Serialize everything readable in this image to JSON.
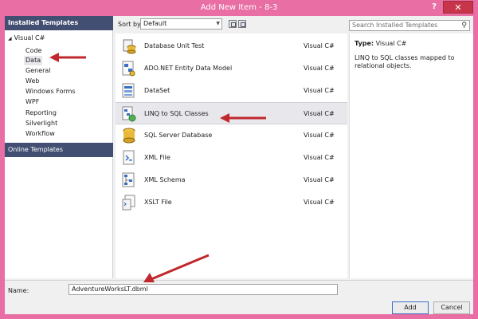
{
  "window": {
    "title": "Add New Item - 8-3",
    "help": "?",
    "close": "✕"
  },
  "left": {
    "header": "Installed Templates",
    "root": "Visual C#",
    "items": [
      {
        "label": "Code",
        "selected": false
      },
      {
        "label": "Data",
        "selected": true
      },
      {
        "label": "General",
        "selected": false
      },
      {
        "label": "Web",
        "selected": false
      },
      {
        "label": "Windows Forms",
        "selected": false
      },
      {
        "label": "WPF",
        "selected": false
      },
      {
        "label": "Reporting",
        "selected": false
      },
      {
        "label": "Silverlight",
        "selected": false
      },
      {
        "label": "Workflow",
        "selected": false
      }
    ],
    "online": "Online Templates"
  },
  "sortbar": {
    "label": "Sort by:",
    "value": "Default"
  },
  "search": {
    "placeholder": "Search Installed Templates"
  },
  "templates": [
    {
      "name": "Database Unit Test",
      "lang": "Visual C#",
      "icon": "database-unit-test-icon",
      "selected": false
    },
    {
      "name": "ADO.NET Entity Data Model",
      "lang": "Visual C#",
      "icon": "entity-data-model-icon",
      "selected": false
    },
    {
      "name": "DataSet",
      "lang": "Visual C#",
      "icon": "dataset-icon",
      "selected": false
    },
    {
      "name": "LINQ to SQL Classes",
      "lang": "Visual C#",
      "icon": "linq-to-sql-icon",
      "selected": true
    },
    {
      "name": "SQL Server Database",
      "lang": "Visual C#",
      "icon": "sql-database-icon",
      "selected": false
    },
    {
      "name": "XML File",
      "lang": "Visual C#",
      "icon": "xml-file-icon",
      "selected": false
    },
    {
      "name": "XML Schema",
      "lang": "Visual C#",
      "icon": "xml-schema-icon",
      "selected": false
    },
    {
      "name": "XSLT File",
      "lang": "Visual C#",
      "icon": "xslt-file-icon",
      "selected": false
    }
  ],
  "details": {
    "type_label": "Type:",
    "type_value": "Visual C#",
    "description": "LINQ to SQL classes mapped to relational objects."
  },
  "bottom": {
    "name_label": "Name:",
    "name_value": "AdventureWorksLT.dbml",
    "add": "Add",
    "cancel": "Cancel"
  },
  "colors": {
    "frame": "#e86ea3",
    "header": "#424f72",
    "arrow": "#c0282d"
  }
}
